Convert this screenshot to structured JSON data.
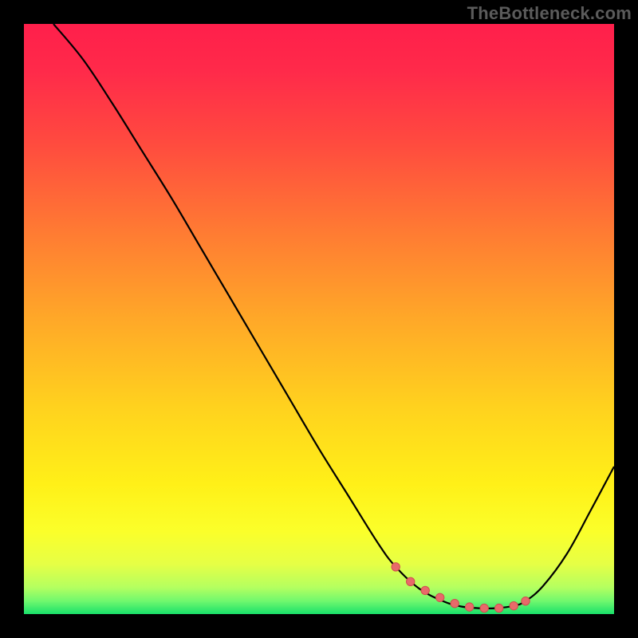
{
  "watermark": "TheBottleneck.com",
  "colors": {
    "frame": "#000000",
    "curve": "#000000",
    "marker_fill": "#e86a6a",
    "marker_stroke": "#d14e4e",
    "gradient_stops": [
      {
        "offset": 0.0,
        "color": "#ff1f4b"
      },
      {
        "offset": 0.08,
        "color": "#ff2a4a"
      },
      {
        "offset": 0.2,
        "color": "#ff4a3f"
      },
      {
        "offset": 0.35,
        "color": "#ff7a33"
      },
      {
        "offset": 0.5,
        "color": "#ffa828"
      },
      {
        "offset": 0.65,
        "color": "#ffd21e"
      },
      {
        "offset": 0.78,
        "color": "#fff018"
      },
      {
        "offset": 0.86,
        "color": "#fbff2a"
      },
      {
        "offset": 0.915,
        "color": "#e6ff45"
      },
      {
        "offset": 0.955,
        "color": "#b4ff60"
      },
      {
        "offset": 0.978,
        "color": "#70f86e"
      },
      {
        "offset": 1.0,
        "color": "#19e06a"
      }
    ]
  },
  "chart_data": {
    "type": "line",
    "title": "",
    "xlabel": "",
    "ylabel": "",
    "x_range": [
      0,
      100
    ],
    "y_range": [
      0,
      100
    ],
    "series": [
      {
        "name": "bottleneck-curve",
        "x": [
          5,
          10,
          15,
          20,
          25,
          30,
          35,
          40,
          45,
          50,
          55,
          60,
          63,
          67,
          71,
          74,
          77,
          80,
          83,
          85,
          88,
          92,
          96,
          100
        ],
        "y": [
          100,
          94,
          86.5,
          78.5,
          70.5,
          62,
          53.5,
          45,
          36.5,
          28,
          20,
          12,
          8,
          4.3,
          2.2,
          1.3,
          1.0,
          1.0,
          1.4,
          2.2,
          4.8,
          10.2,
          17.5,
          25
        ]
      }
    ],
    "markers": {
      "name": "highlighted-trough",
      "x": [
        63.0,
        65.5,
        68.0,
        70.5,
        73.0,
        75.5,
        78.0,
        80.5,
        83.0,
        85.0
      ],
      "y": [
        8.0,
        5.5,
        4.0,
        2.8,
        1.8,
        1.2,
        1.0,
        1.0,
        1.4,
        2.2
      ]
    }
  }
}
